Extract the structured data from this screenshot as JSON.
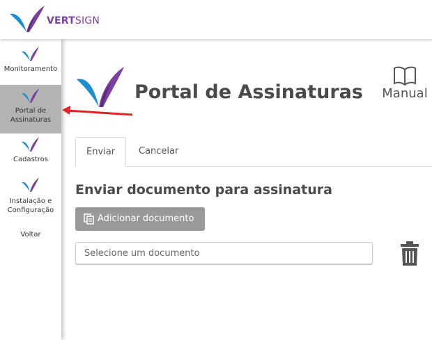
{
  "header": {
    "brand_part1": "VERT",
    "brand_part2": "SIGN"
  },
  "sidebar": {
    "items": [
      {
        "label": "Monitoramento"
      },
      {
        "label": "Portal de Assinaturas"
      },
      {
        "label": "Cadastros"
      },
      {
        "label": "Instalação e Configuração"
      },
      {
        "label": "Voltar"
      }
    ]
  },
  "page": {
    "title": "Portal de Assinaturas",
    "manual_label": "Manual"
  },
  "tabs": [
    {
      "label": "Enviar"
    },
    {
      "label": "Cancelar"
    }
  ],
  "send": {
    "heading": "Enviar documento para assinatura",
    "add_button": "Adicionar documento",
    "input_placeholder": "Selecione um documento"
  },
  "colors": {
    "brand_purple": "#7b3f9e",
    "brand_blue": "#1a8fd0",
    "arrow_red": "#e52222",
    "active_sidebar": "#b3b3b3"
  },
  "icons": [
    "vertsign-logo-icon",
    "book-icon",
    "files-icon",
    "trash-icon",
    "arrow-icon"
  ]
}
